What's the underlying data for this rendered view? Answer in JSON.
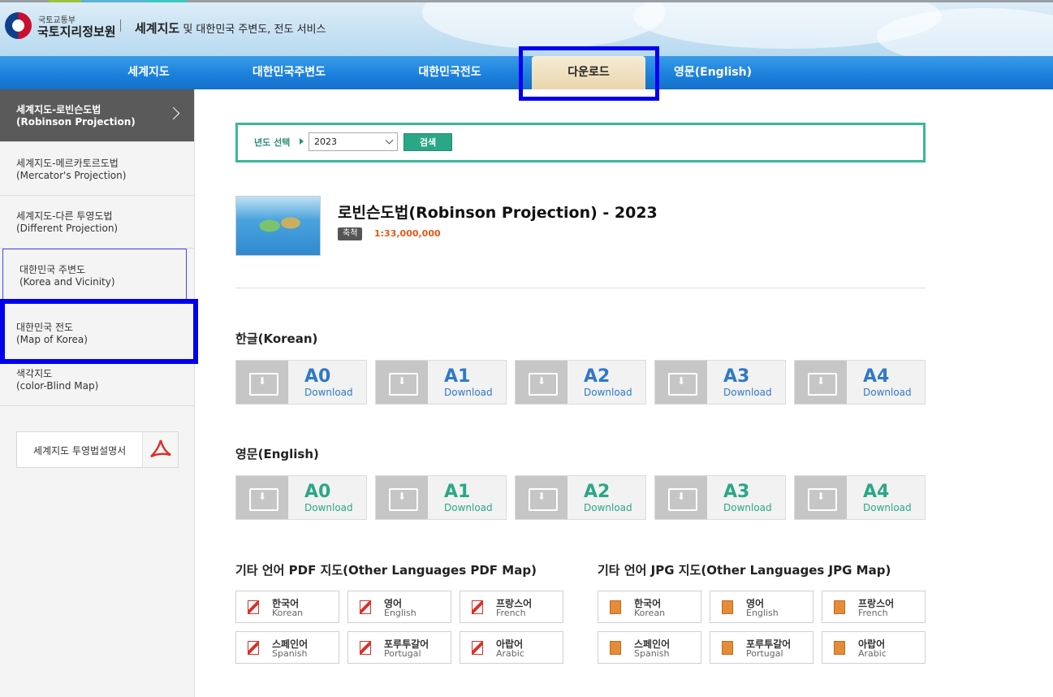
{
  "header": {
    "ministry": "국토교통부",
    "agency": "국토지리정보원",
    "service_bold": "세계지도",
    "service_rest": " 및 대한민국 주변도, 전도 서비스"
  },
  "nav": {
    "items": [
      "세계지도",
      "대한민국주변도",
      "대한민국전도",
      "다운로드",
      "영문(English)"
    ],
    "active_index": 3
  },
  "sidebar": {
    "items": [
      {
        "label": "세계지도-로빈슨도법",
        "sub": "(Robinson Projection)"
      },
      {
        "label": "세계지도-메르카토르도법",
        "sub": "(Mercator's Projection)"
      },
      {
        "label": "세계지도-다른 투영도법",
        "sub": "(Different Projection)"
      },
      {
        "label": "대한민국 주변도",
        "sub": "(Korea and Vicinity)"
      },
      {
        "label": "대한민국 전도",
        "sub": "(Map of Korea)"
      },
      {
        "label": "색각지도",
        "sub": "(color-Blind Map)"
      }
    ],
    "active_index": 0,
    "manual_button": "세계지도 투영법설명서"
  },
  "year_filter": {
    "label": "년도 선택",
    "selected": "2023",
    "search_button": "검색"
  },
  "map_info": {
    "title": "로빈슨도법(Robinson Projection) - 2023",
    "scale_label": "축척",
    "scale_value": "1:33,000,000"
  },
  "korean_section": {
    "title": "한글(Korean)",
    "buttons": [
      {
        "size": "A0",
        "label": "Download"
      },
      {
        "size": "A1",
        "label": "Download"
      },
      {
        "size": "A2",
        "label": "Download"
      },
      {
        "size": "A3",
        "label": "Download"
      },
      {
        "size": "A4",
        "label": "Download"
      }
    ]
  },
  "english_section": {
    "title": "영문(English)",
    "buttons": [
      {
        "size": "A0",
        "label": "Download"
      },
      {
        "size": "A1",
        "label": "Download"
      },
      {
        "size": "A2",
        "label": "Download"
      },
      {
        "size": "A3",
        "label": "Download"
      },
      {
        "size": "A4",
        "label": "Download"
      }
    ]
  },
  "other_pdf": {
    "title": "기타 언어 PDF 지도(Other Languages PDF Map)",
    "languages": [
      {
        "ko": "한국어",
        "en": "Korean"
      },
      {
        "ko": "영어",
        "en": "English"
      },
      {
        "ko": "프랑스어",
        "en": "French"
      },
      {
        "ko": "스페인어",
        "en": "Spanish"
      },
      {
        "ko": "포루투갈어",
        "en": "Portugal"
      },
      {
        "ko": "아랍어",
        "en": "Arabic"
      }
    ]
  },
  "other_jpg": {
    "title": "기타 언어 JPG 지도(Other Languages JPG Map)",
    "languages": [
      {
        "ko": "한국어",
        "en": "Korean"
      },
      {
        "ko": "영어",
        "en": "English"
      },
      {
        "ko": "프랑스어",
        "en": "French"
      },
      {
        "ko": "스페인어",
        "en": "Spanish"
      },
      {
        "ko": "포루투갈어",
        "en": "Portugal"
      },
      {
        "ko": "아랍어",
        "en": "Arabic"
      }
    ]
  },
  "colors": {
    "nav_blue": "#1a7fdb",
    "teal": "#2aa786",
    "link_blue": "#2f79c8",
    "scale_orange": "#e05a1a",
    "highlight": "#0000f0"
  }
}
